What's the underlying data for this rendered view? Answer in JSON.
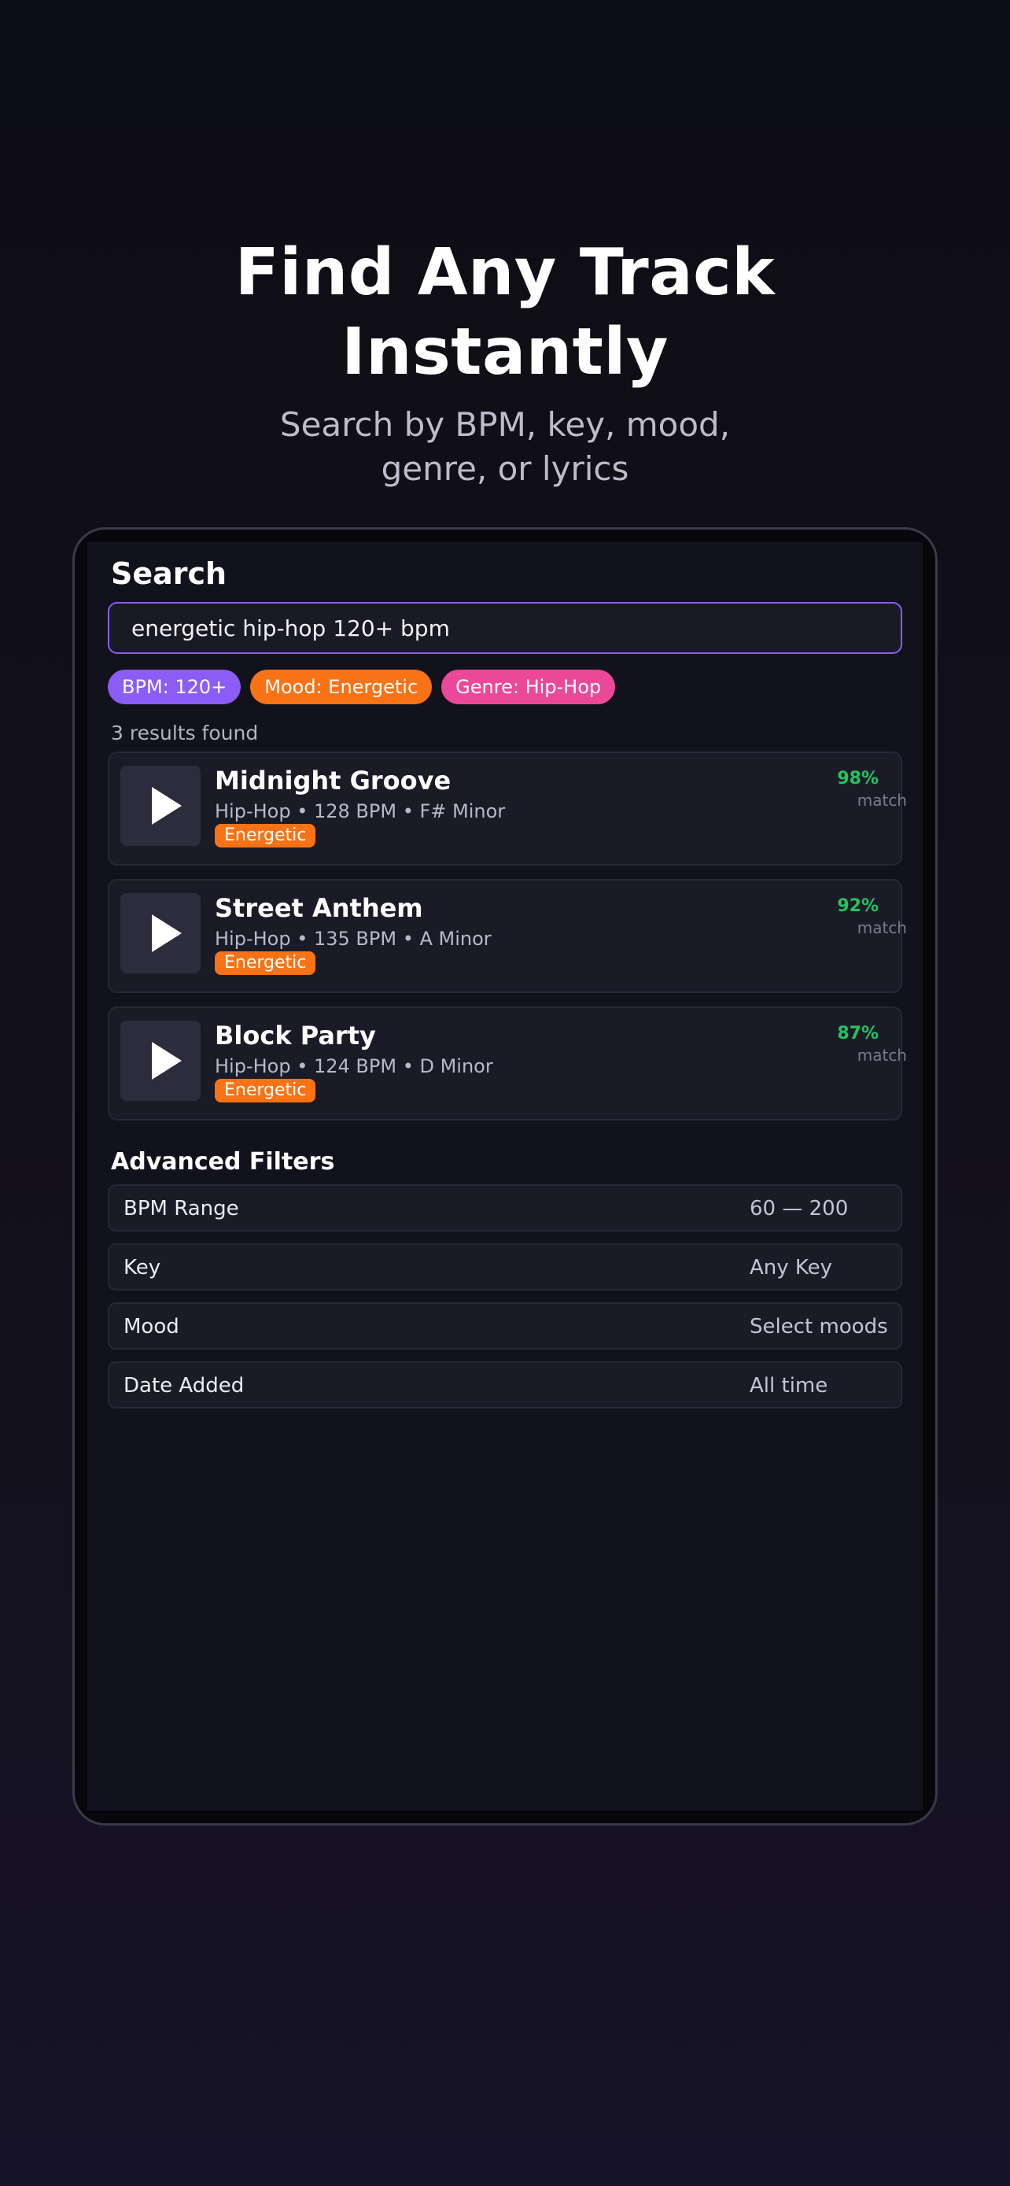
{
  "hero": {
    "title_line1": "Find Any Track",
    "title_line2": "Instantly",
    "subtitle_line1": "Search by BPM, key, mood,",
    "subtitle_line2": "genre, or lyrics"
  },
  "search": {
    "title": "Search",
    "query": "energetic hip-hop 120+ bpm"
  },
  "chips": [
    {
      "label": "BPM: 120+",
      "color": "#8b5cf6"
    },
    {
      "label": "Mood: Energetic",
      "color": "#f97316"
    },
    {
      "label": "Genre: Hip-Hop",
      "color": "#ec4899"
    }
  ],
  "results": {
    "count_text": "3 results found",
    "items": [
      {
        "title": "Midnight Groove",
        "meta": "Hip-Hop • 128 BPM • F# Minor",
        "mood": "Energetic",
        "match": "98%",
        "match_label": "match"
      },
      {
        "title": "Street Anthem",
        "meta": "Hip-Hop • 135 BPM • A Minor",
        "mood": "Energetic",
        "match": "92%",
        "match_label": "match"
      },
      {
        "title": "Block Party",
        "meta": "Hip-Hop • 124 BPM • D Minor",
        "mood": "Energetic",
        "match": "87%",
        "match_label": "match"
      }
    ]
  },
  "filters": {
    "title": "Advanced Filters",
    "items": [
      {
        "label": "BPM Range",
        "value": "60 — 200"
      },
      {
        "label": "Key",
        "value": "Any Key"
      },
      {
        "label": "Mood",
        "value": "Select moods"
      },
      {
        "label": "Date Added",
        "value": "All time"
      }
    ]
  },
  "colors": {
    "accent": "#8b5cf6",
    "mood_badge": "#f97316",
    "match": "#22c55e"
  },
  "icons": {
    "play": "play-icon"
  }
}
